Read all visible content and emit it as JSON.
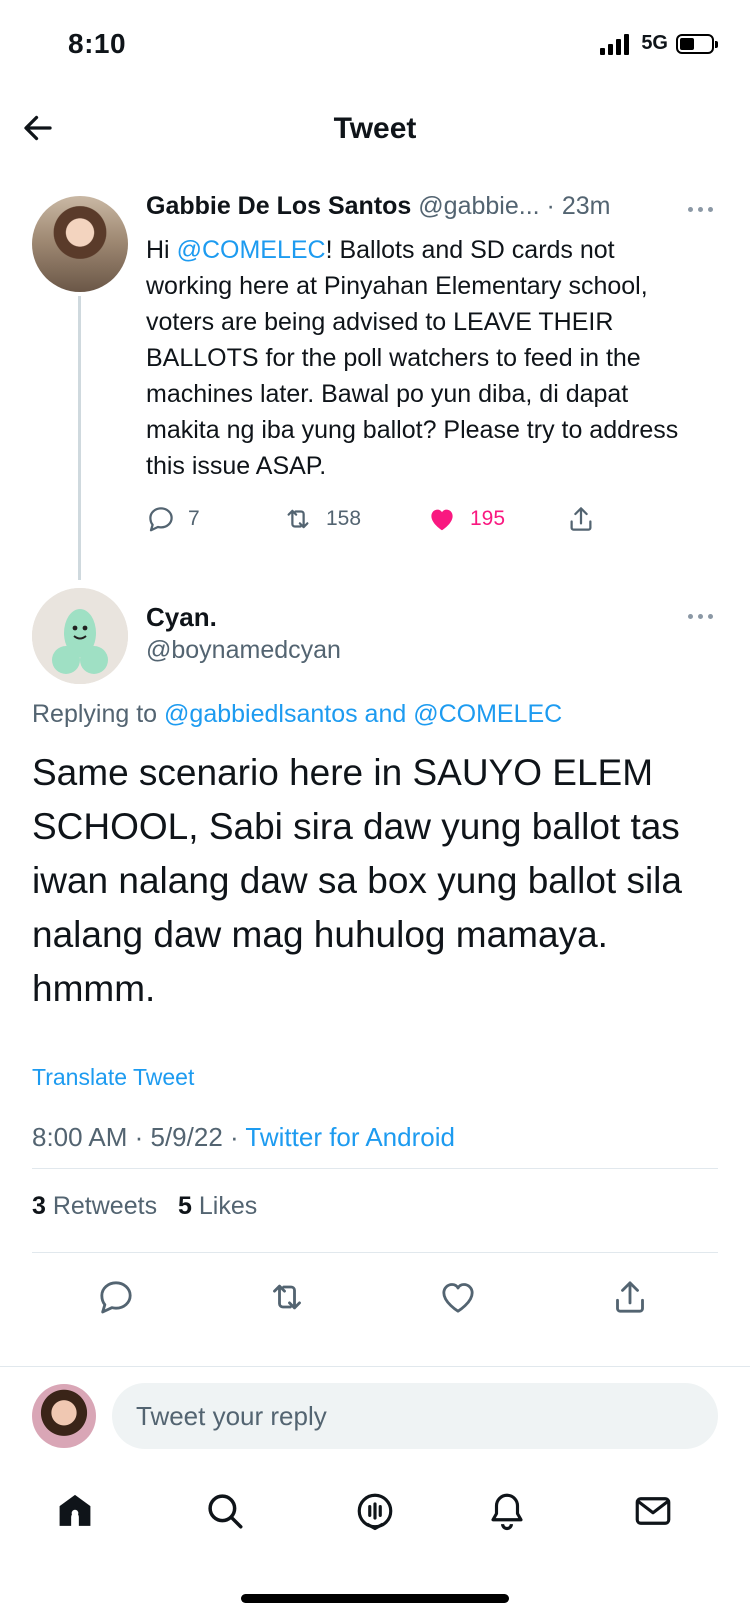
{
  "status_bar": {
    "time": "8:10",
    "network": "5G"
  },
  "header": {
    "title": "Tweet"
  },
  "parent_tweet": {
    "display_name": "Gabbie De Los Santos",
    "handle": "@gabbie...",
    "time_ago": "· 23m",
    "text_before_mention": "Hi ",
    "mention": "@COMELEC",
    "text_after_mention": "! Ballots and SD cards not working here at Pinyahan Elementary school, voters are being advised to LEAVE THEIR BALLOTS for the poll watchers to feed in the machines later. Bawal po yun diba, di dapat makita ng iba yung ballot? Please try to address this issue ASAP.",
    "replies": "7",
    "retweets": "158",
    "likes": "195",
    "liked": true
  },
  "main_tweet": {
    "display_name": "Cyan.",
    "handle": "@boynamedcyan",
    "replying_prefix": "Replying to ",
    "replying_user1": "@gabbiedlsantos",
    "replying_and": " and ",
    "replying_user2": "@COMELEC",
    "text": "Same scenario here in SAUYO ELEM SCHOOL, Sabi sira daw yung ballot tas iwan nalang daw sa box yung ballot sila nalang daw mag huhulog mamaya. hmmm.",
    "translate_label": "Translate Tweet",
    "time": "8:00 AM · 5/9/22 · ",
    "source": "Twitter for Android",
    "retweet_count": "3",
    "retweet_label": " Retweets",
    "like_count": "5",
    "like_label": " Likes"
  },
  "reply_bar": {
    "placeholder": "Tweet your reply"
  },
  "tab_bar": [
    "home-icon",
    "search-icon",
    "spaces-icon",
    "notifications-icon",
    "messages-icon"
  ],
  "colors": {
    "accent": "#1d9bf0",
    "like": "#f91880",
    "text": "#0f1419",
    "secondary": "#536471"
  }
}
